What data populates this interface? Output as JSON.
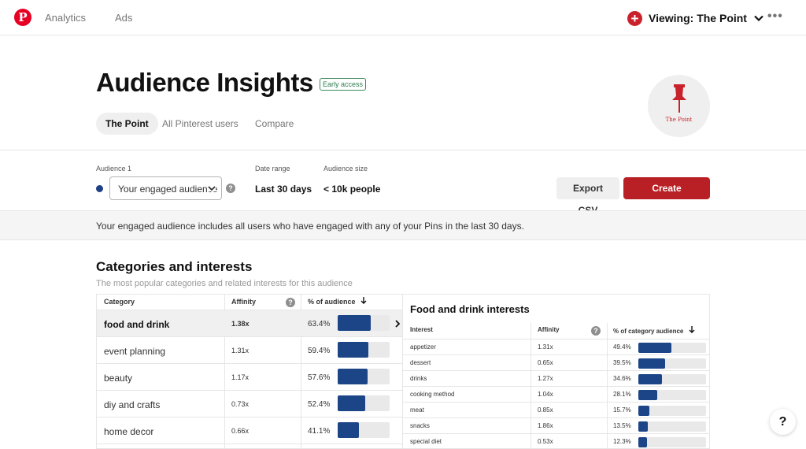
{
  "topbar": {
    "logo_glyph": "P",
    "nav": [
      "Analytics",
      "Ads"
    ],
    "viewing_label": "Viewing: The Point",
    "more_glyph": "•••"
  },
  "header": {
    "title": "Audience Insights",
    "badge": "Early access",
    "tabs": [
      "The Point",
      "All Pinterest users",
      "Compare"
    ],
    "active_tab": "The Point",
    "brand_name": "The Point"
  },
  "controls": {
    "audience_label": "Audience 1",
    "audience_value": "Your engaged audience",
    "date_range_label": "Date range",
    "date_range_value": "Last 30 days",
    "audience_size_label": "Audience size",
    "audience_size_value": "< 10k people",
    "export_label": "Export CSV",
    "create_label": "Create campaign"
  },
  "info_text": "Your engaged audience includes all users who have engaged with any of your Pins in the last 30 days.",
  "categories": {
    "title": "Categories and interests",
    "subtitle": "The most popular categories and related interests for this audience",
    "headers": {
      "category": "Category",
      "affinity": "Affinity",
      "pct": "% of audience"
    },
    "rows": [
      {
        "name": "food and drink",
        "affinity": "1.38x",
        "pct": "63.4%",
        "fraction": 0.634,
        "selected": true
      },
      {
        "name": "event planning",
        "affinity": "1.31x",
        "pct": "59.4%",
        "fraction": 0.594
      },
      {
        "name": "beauty",
        "affinity": "1.17x",
        "pct": "57.6%",
        "fraction": 0.576
      },
      {
        "name": "diy and crafts",
        "affinity": "0.73x",
        "pct": "52.4%",
        "fraction": 0.524
      },
      {
        "name": "home decor",
        "affinity": "0.66x",
        "pct": "41.1%",
        "fraction": 0.411
      },
      {
        "name": "",
        "affinity": "",
        "pct": "",
        "fraction": 0.4
      }
    ]
  },
  "interests": {
    "title": "Food and drink interests",
    "headers": {
      "interest": "Interest",
      "affinity": "Affinity",
      "pct": "% of category audience"
    },
    "rows": [
      {
        "name": "appetizer",
        "affinity": "1.31x",
        "pct": "49.4%",
        "fraction": 0.494
      },
      {
        "name": "dessert",
        "affinity": "0.65x",
        "pct": "39.5%",
        "fraction": 0.395
      },
      {
        "name": "drinks",
        "affinity": "1.27x",
        "pct": "34.6%",
        "fraction": 0.346
      },
      {
        "name": "cooking method",
        "affinity": "1.04x",
        "pct": "28.1%",
        "fraction": 0.281
      },
      {
        "name": "meat",
        "affinity": "0.85x",
        "pct": "15.7%",
        "fraction": 0.157
      },
      {
        "name": "snacks",
        "affinity": "1.86x",
        "pct": "13.5%",
        "fraction": 0.135
      },
      {
        "name": "special diet",
        "affinity": "0.53x",
        "pct": "12.3%",
        "fraction": 0.123
      }
    ]
  },
  "help_glyph": "?",
  "colors": {
    "accent_red": "#b82025",
    "bar_blue": "#1c4587",
    "badge_green": "#2e7d4f"
  }
}
